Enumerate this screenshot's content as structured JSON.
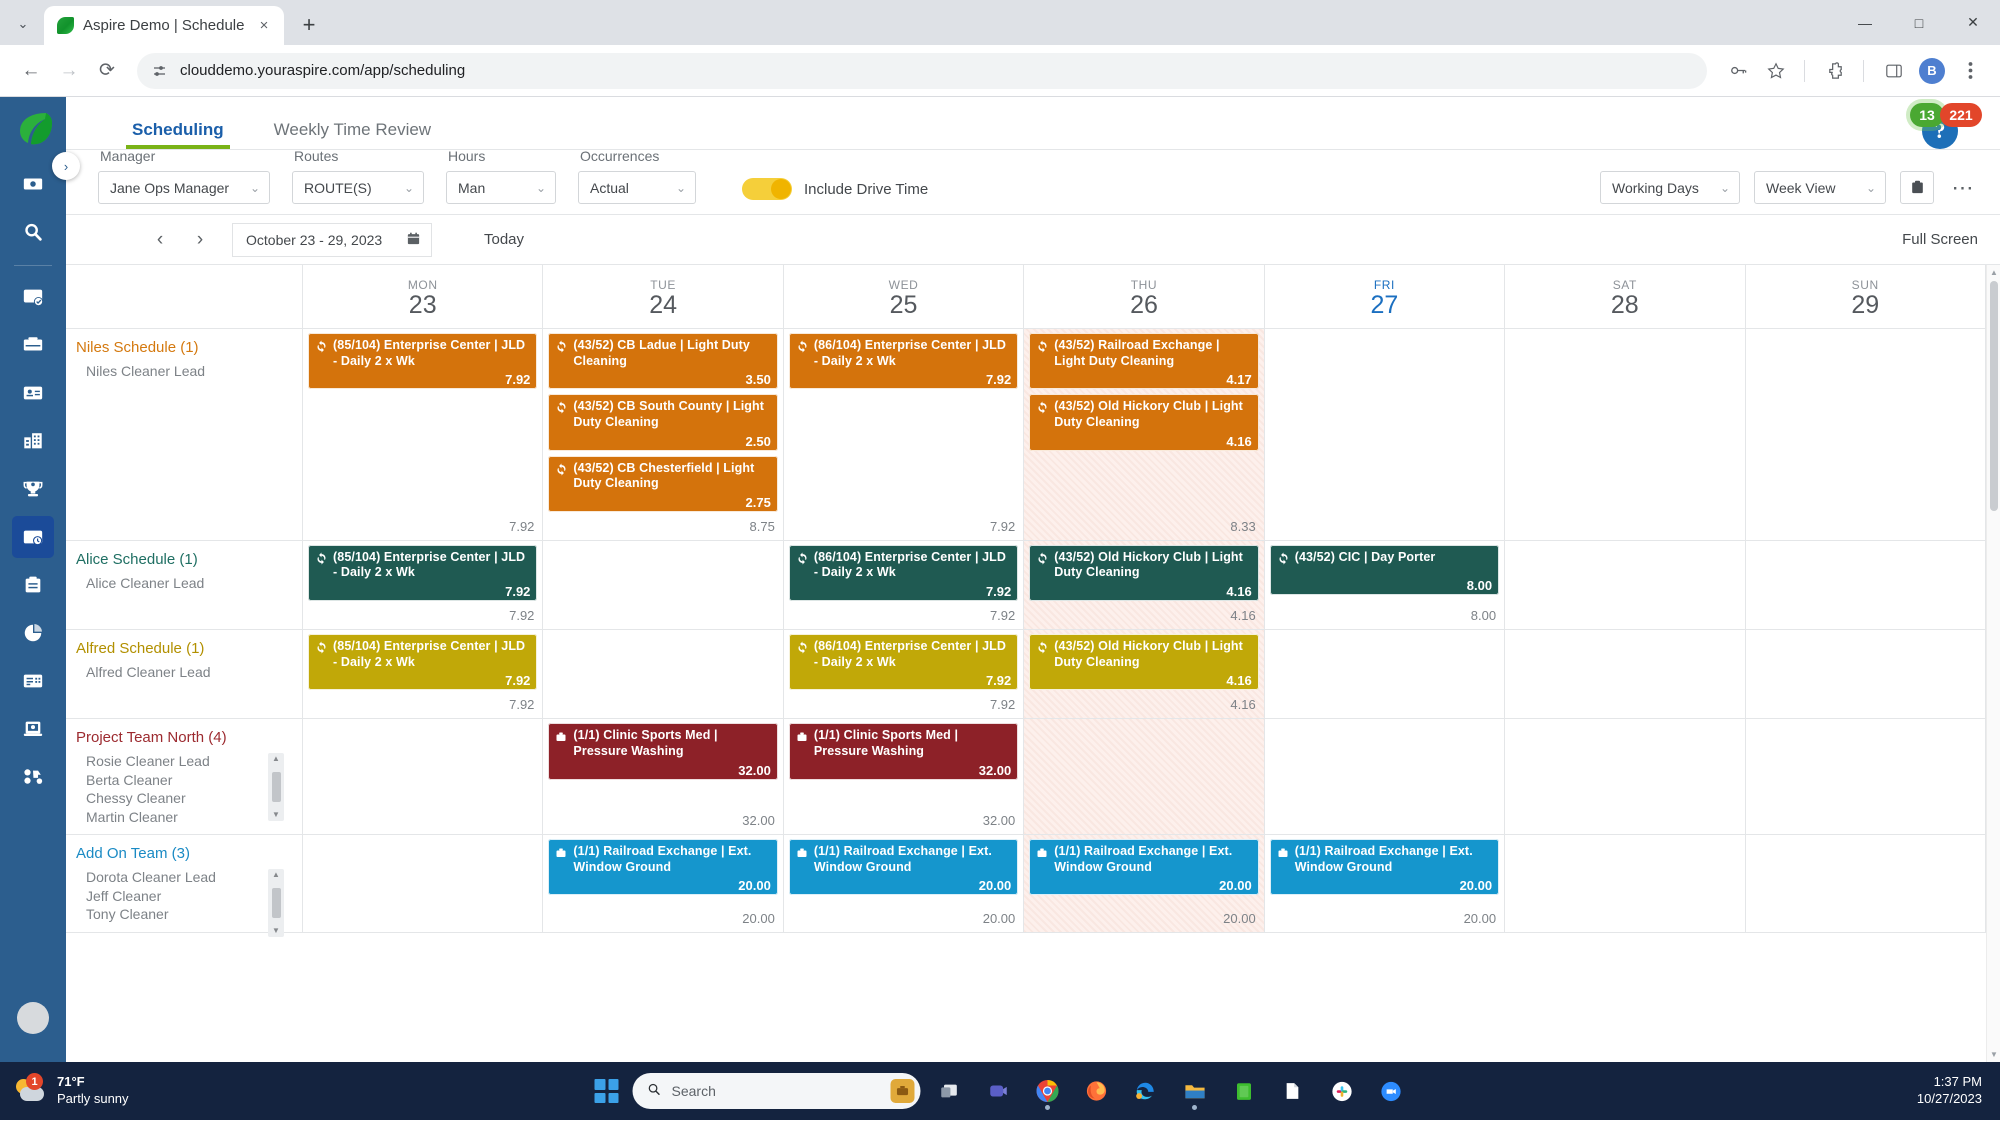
{
  "browser": {
    "tab_title": "Aspire Demo | Schedule",
    "url": "clouddemo.youraspire.com/app/scheduling",
    "new_tab_label": "+",
    "close_label": "×",
    "tab_list_chevron": "⌄",
    "back_label": "←",
    "forward_label": "→",
    "reload_label": "⟳",
    "profile_initial": "B",
    "minimize_label": "—",
    "maximize_label": "□",
    "close_window_label": "✕"
  },
  "app": {
    "tabs": [
      {
        "label": "Scheduling",
        "active": true
      },
      {
        "label": "Weekly Time Review",
        "active": false
      }
    ],
    "badges": {
      "green": "13",
      "red": "221",
      "help": "?"
    },
    "rail_expand": "›"
  },
  "filters": {
    "manager": {
      "label": "Manager",
      "value": "Jane Ops Manager"
    },
    "routes": {
      "label": "Routes",
      "value": "ROUTE(S)"
    },
    "hours": {
      "label": "Hours",
      "value": "Man"
    },
    "occurrences": {
      "label": "Occurrences",
      "value": "Actual"
    },
    "drive_time_toggle_label": "Include Drive Time",
    "drive_time_on": true,
    "working_days": "Working Days",
    "week_view": "Week View",
    "chevron": "⌄"
  },
  "datebar": {
    "prev": "‹",
    "next": "›",
    "range": "October 23 - 29, 2023",
    "today": "Today",
    "full_screen": "Full Screen"
  },
  "calendar": {
    "resource_col_header": "",
    "days": [
      {
        "dow": "MON",
        "date": "23",
        "today": false,
        "shaded": false
      },
      {
        "dow": "TUE",
        "date": "24",
        "today": false,
        "shaded": false
      },
      {
        "dow": "WED",
        "date": "25",
        "today": false,
        "shaded": false
      },
      {
        "dow": "THU",
        "date": "26",
        "today": false,
        "shaded": true
      },
      {
        "dow": "FRI",
        "date": "27",
        "today": true,
        "shaded": false
      },
      {
        "dow": "SAT",
        "date": "28",
        "today": false,
        "shaded": false
      },
      {
        "dow": "SUN",
        "date": "29",
        "today": false,
        "shaded": false
      }
    ],
    "rows": [
      {
        "name": "Niles Schedule (1)",
        "color": "orange",
        "members": [
          "Niles Cleaner Lead"
        ],
        "has_scroll": false,
        "cells": [
          {
            "total": "7.92",
            "events": [
              {
                "title": "(85/104) Enterprise Center | JLD - Daily 2 x Wk",
                "hours": "7.92",
                "icon": "recurring-icon"
              }
            ]
          },
          {
            "total": "8.75",
            "events": [
              {
                "title": "(43/52) CB Ladue | Light Duty Cleaning",
                "hours": "3.50",
                "icon": "recurring-icon"
              },
              {
                "title": "(43/52) CB South County | Light Duty Cleaning",
                "hours": "2.50",
                "icon": "recurring-icon"
              },
              {
                "title": "(43/52) CB Chesterfield | Light Duty Cleaning",
                "hours": "2.75",
                "icon": "recurring-icon"
              }
            ]
          },
          {
            "total": "7.92",
            "events": [
              {
                "title": "(86/104) Enterprise Center | JLD - Daily 2 x Wk",
                "hours": "7.92",
                "icon": "recurring-icon"
              }
            ]
          },
          {
            "total": "8.33",
            "events": [
              {
                "title": "(43/52) Railroad Exchange | Light Duty Cleaning",
                "hours": "4.17",
                "icon": "recurring-icon"
              },
              {
                "title": "(43/52) Old Hickory Club | Light Duty Cleaning",
                "hours": "4.16",
                "icon": "recurring-icon"
              }
            ]
          },
          {
            "total": "",
            "events": []
          },
          {
            "total": "",
            "events": []
          },
          {
            "total": "",
            "events": []
          }
        ]
      },
      {
        "name": "Alice Schedule (1)",
        "color": "teal",
        "members": [
          "Alice Cleaner Lead"
        ],
        "has_scroll": false,
        "cells": [
          {
            "total": "7.92",
            "events": [
              {
                "title": "(85/104) Enterprise Center | JLD - Daily 2 x Wk",
                "hours": "7.92",
                "icon": "recurring-icon"
              }
            ]
          },
          {
            "total": "",
            "events": []
          },
          {
            "total": "7.92",
            "events": [
              {
                "title": "(86/104) Enterprise Center | JLD - Daily 2 x Wk",
                "hours": "7.92",
                "icon": "recurring-icon"
              }
            ]
          },
          {
            "total": "4.16",
            "events": [
              {
                "title": "(43/52) Old Hickory Club | Light Duty Cleaning",
                "hours": "4.16",
                "icon": "recurring-icon"
              }
            ]
          },
          {
            "total": "8.00",
            "events": [
              {
                "title": "(43/52) CIC | Day Porter",
                "hours": "8.00",
                "icon": "recurring-icon"
              }
            ]
          },
          {
            "total": "",
            "events": []
          },
          {
            "total": "",
            "events": []
          }
        ]
      },
      {
        "name": "Alfred Schedule (1)",
        "color": "olive",
        "members": [
          "Alfred Cleaner Lead"
        ],
        "has_scroll": false,
        "cells": [
          {
            "total": "7.92",
            "events": [
              {
                "title": "(85/104) Enterprise Center | JLD - Daily 2 x Wk",
                "hours": "7.92",
                "icon": "recurring-icon"
              }
            ]
          },
          {
            "total": "",
            "events": []
          },
          {
            "total": "7.92",
            "events": [
              {
                "title": "(86/104) Enterprise Center | JLD - Daily 2 x Wk",
                "hours": "7.92",
                "icon": "recurring-icon"
              }
            ]
          },
          {
            "total": "4.16",
            "events": [
              {
                "title": "(43/52) Old Hickory Club | Light Duty Cleaning",
                "hours": "4.16",
                "icon": "recurring-icon"
              }
            ]
          },
          {
            "total": "",
            "events": []
          },
          {
            "total": "",
            "events": []
          },
          {
            "total": "",
            "events": []
          }
        ]
      },
      {
        "name": "Project Team North (4)",
        "color": "maroon",
        "members": [
          "Rosie Cleaner Lead",
          "Berta Cleaner",
          "Chessy Cleaner",
          "Martin Cleaner"
        ],
        "has_scroll": true,
        "cells": [
          {
            "total": "",
            "events": []
          },
          {
            "total": "32.00",
            "events": [
              {
                "title": "(1/1) Clinic Sports Med | Pressure Washing",
                "hours": "32.00",
                "icon": "job-icon"
              }
            ]
          },
          {
            "total": "32.00",
            "events": [
              {
                "title": "(1/1) Clinic Sports Med | Pressure Washing",
                "hours": "32.00",
                "icon": "job-icon"
              }
            ]
          },
          {
            "total": "",
            "events": []
          },
          {
            "total": "",
            "events": []
          },
          {
            "total": "",
            "events": []
          },
          {
            "total": "",
            "events": []
          }
        ]
      },
      {
        "name": "Add On Team (3)",
        "color": "blue",
        "members": [
          "Dorota Cleaner Lead",
          "Jeff Cleaner",
          "Tony Cleaner"
        ],
        "has_scroll": true,
        "cells": [
          {
            "total": "",
            "events": []
          },
          {
            "total": "20.00",
            "events": [
              {
                "title": "(1/1) Railroad Exchange | Ext. Window Ground",
                "hours": "20.00",
                "icon": "job-icon"
              }
            ]
          },
          {
            "total": "20.00",
            "events": [
              {
                "title": "(1/1) Railroad Exchange | Ext. Window Ground",
                "hours": "20.00",
                "icon": "job-icon"
              }
            ]
          },
          {
            "total": "20.00",
            "events": [
              {
                "title": "(1/1) Railroad Exchange | Ext. Window Ground",
                "hours": "20.00",
                "icon": "job-icon"
              }
            ]
          },
          {
            "total": "20.00",
            "events": [
              {
                "title": "(1/1) Railroad Exchange | Ext. Window Ground",
                "hours": "20.00",
                "icon": "job-icon"
              }
            ]
          },
          {
            "total": "",
            "events": []
          },
          {
            "total": "",
            "events": []
          }
        ]
      }
    ]
  },
  "taskbar": {
    "weather_temp": "71°F",
    "weather_desc": "Partly sunny",
    "weather_badge": "1",
    "search_placeholder": "Search",
    "time": "1:37 PM",
    "date": "10/27/2023"
  },
  "colors": {
    "orange": "#d4730c",
    "teal": "#1f5a52",
    "olive": "#c1a808",
    "maroon": "#8d2128",
    "blue": "#1596cd",
    "accent_green": "#7ab317",
    "rail": "#2c5e8e"
  }
}
